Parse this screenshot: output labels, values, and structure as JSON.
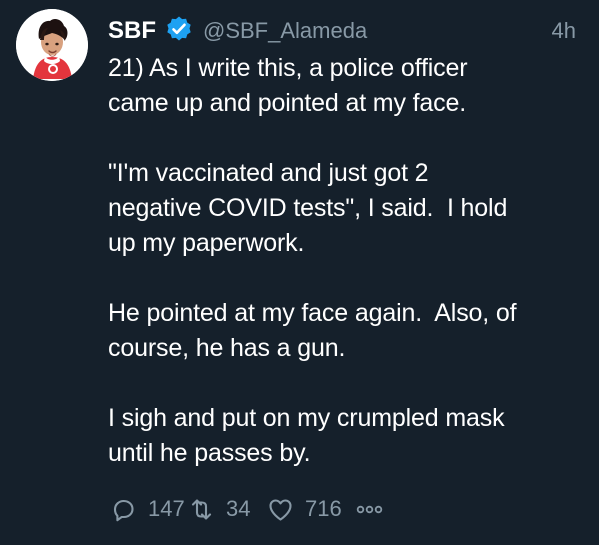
{
  "tweet": {
    "author": {
      "name": "SBF",
      "handle": "@SBF_Alameda",
      "verified": true
    },
    "timestamp": "4h",
    "text": "21) As I write this, a police officer\ncame up and pointed at my face.\n\n\"I'm vaccinated and just got 2\nnegative COVID tests\", I said.  I hold\nup my paperwork.\n\nHe pointed at my face again.  Also, of\ncourse, he has a gun.\n\nI sigh and put on my crumpled mask\nuntil he passes by.",
    "actions": {
      "reply_count": "147",
      "retweet_count": "34",
      "like_count": "716"
    },
    "icons": {
      "avatar": "profile-avatar",
      "verified": "verified-badge-icon",
      "reply": "reply-icon",
      "retweet": "retweet-icon",
      "like": "heart-icon",
      "more": "more-icon"
    }
  },
  "colors": {
    "background": "#15202b",
    "text": "#ffffff",
    "secondary_text": "#8899a6",
    "accent": "#1da1f2"
  }
}
